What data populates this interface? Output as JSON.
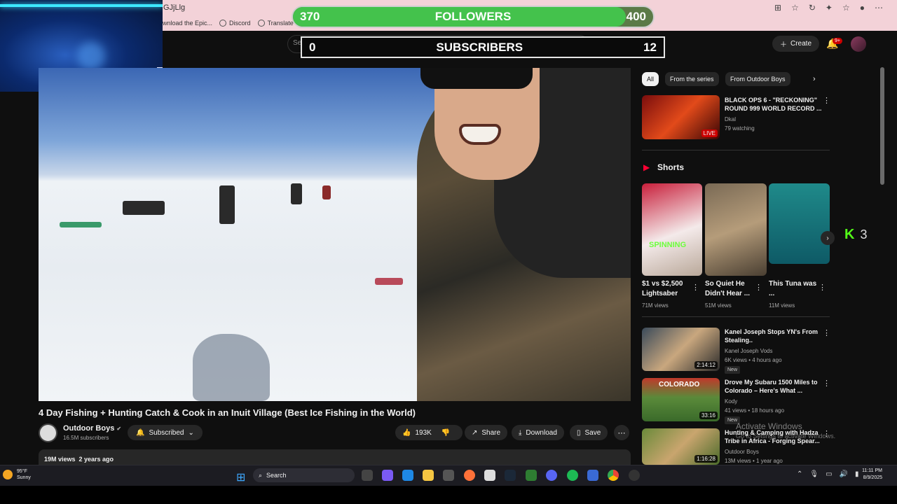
{
  "browser": {
    "url": "GJjLlg",
    "bookmarks": [
      "wnload the Epic...",
      "Discord",
      "Translate"
    ]
  },
  "overlays": {
    "followers": {
      "current": "370",
      "label": "FOLLOWERS",
      "goal": "400",
      "progress": 0.925,
      "fill_color": "#44c24c"
    },
    "subscribers": {
      "current": "0",
      "label": "SUBSCRIBERS",
      "goal": "12"
    }
  },
  "youtube_header": {
    "search_placeholder": "Search",
    "create_label": "Create",
    "notif_badge": "9+"
  },
  "video": {
    "title": "4 Day Fishing + Hunting Catch & Cook in an Inuit Village (Best Ice Fishing in the World)",
    "channel": {
      "name": "Outdoor Boys",
      "verified": "✔",
      "subscribers": "16.5M subscribers"
    },
    "subscribe_label": "Subscribed",
    "likes": "193K",
    "share_label": "Share",
    "download_label": "Download",
    "save_label": "Save",
    "stats": "19M views  2 years ago"
  },
  "chips": [
    "All",
    "From the series",
    "From Outdoor Boys"
  ],
  "recommendations": [
    {
      "title": "BLACK OPS 6 - \"RECKONING\" ROUND 999 WORLD RECORD ...",
      "channel": "Dkal",
      "meta": "79 watching",
      "badge": "LIVE"
    },
    {
      "title": "Kanel Joseph Stops YN's From Stealing..",
      "channel": "Kanel Joseph Vods",
      "meta": "6K views • 4 hours ago",
      "duration": "2:14:12",
      "new": "New"
    },
    {
      "title": "Drove My Subaru 1500 Miles to Colorado – Here's What ...",
      "channel": "Kody",
      "meta": "41 views • 18 hours ago",
      "duration": "33:16",
      "new": "New",
      "thumb_text": "COLORADO"
    },
    {
      "title": "Hunting & Camping with Hadza Tribe in Africa - Forging Spear...",
      "channel": "Outdoor Boys",
      "meta": "13M views • 1 year ago",
      "duration": "1:16:28"
    }
  ],
  "shorts": {
    "label": "Shorts",
    "items": [
      {
        "title": "$1 vs $2,500 Lightsaber",
        "views": "71M views",
        "thumb_text": "SPINNING"
      },
      {
        "title": "So Quiet He Didn't Hear ...",
        "views": "51M views"
      },
      {
        "title": "This Tuna was ...",
        "views": "11M views"
      }
    ]
  },
  "kick": {
    "logo": "K",
    "count": "3"
  },
  "watermark": {
    "title": "Activate Windows",
    "subtitle": "Go to Settings to activate Windows."
  },
  "taskbar": {
    "weather_temp": "95°F",
    "weather_desc": "Sunny",
    "search_label": "Search",
    "time": "11:11 PM",
    "date": "8/9/2025"
  }
}
